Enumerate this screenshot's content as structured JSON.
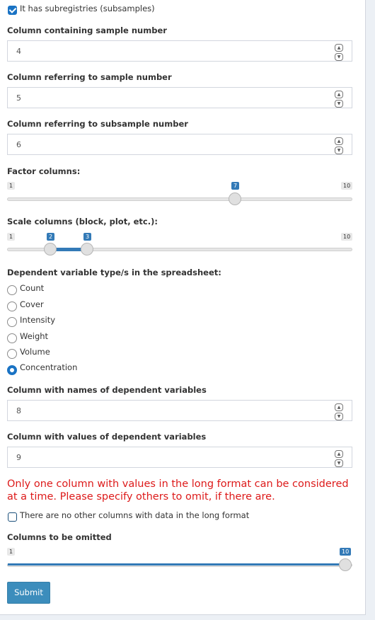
{
  "subregistries": {
    "label": "It has subregistries (subsamples)",
    "checked": true
  },
  "sample_col": {
    "label": "Column containing sample number",
    "value": "4"
  },
  "ref_sample_col": {
    "label": "Column referring to sample number",
    "value": "5"
  },
  "ref_subsample_col": {
    "label": "Column referring to subsample number",
    "value": "6"
  },
  "factor_cols": {
    "label": "Factor columns:",
    "min": "1",
    "max": "10",
    "value": "7",
    "fraction": 0.6667
  },
  "scale_cols": {
    "label": "Scale columns (block, plot, etc.):",
    "min": "1",
    "max": "10",
    "from": "2",
    "to": "3",
    "from_fraction": 0.1111,
    "to_fraction": 0.2222
  },
  "dep_type": {
    "label": "Dependent variable type/s in the spreadsheet:",
    "options": [
      "Count",
      "Cover",
      "Intensity",
      "Weight",
      "Volume",
      "Concentration"
    ],
    "selected": "Concentration"
  },
  "dep_names_col": {
    "label": "Column with names of dependent variables",
    "value": "8"
  },
  "dep_values_col": {
    "label": "Column with values of dependent variables",
    "value": "9"
  },
  "warning": "Only one column with values in the long format can be considered at a time. Please specify others to omit, if there are.",
  "no_other_cols": {
    "label": "There are no other columns with data in the long format",
    "checked": false
  },
  "omit_cols": {
    "label": "Columns to be omitted",
    "min": "1",
    "max": "10",
    "value": "10",
    "fraction": 1.0
  },
  "submit_label": "Submit",
  "colors": {
    "accent": "#337ab7",
    "warning": "#dd1a1a",
    "button": "#3c8dbc"
  }
}
